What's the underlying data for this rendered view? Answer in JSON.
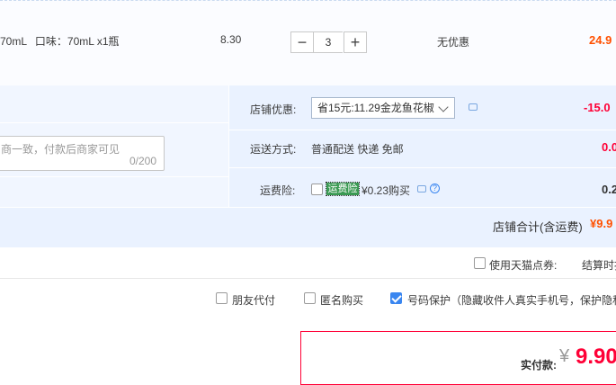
{
  "item": {
    "title_fragment": "70mL",
    "spec": "口味：70mL x1瓶",
    "unit_price": "8.30",
    "quantity": "3",
    "discount": "无优惠",
    "subtotal": "24.9"
  },
  "shop": {
    "remark_placeholder": "商一致，付款后商家可见",
    "remark_counter": "0/200",
    "promo_label": "店铺优惠:",
    "promo_selected": "省15元:11.29金龙鱼花椒",
    "promo_amount": "-15.0",
    "shipping_label": "运送方式:",
    "shipping_value": "普通配送 快递 免邮",
    "shipping_amount": "0.0",
    "insurance_label": "运费险:",
    "insurance_badge": "运费险",
    "insurance_price": "¥0.23购买",
    "insurance_amount": "0.2",
    "total_label": "店铺合计(含运费)",
    "total_amount": "¥9.9"
  },
  "options": {
    "tmall_points": "使用天猫点券:",
    "checkout_note": "结算时扣",
    "friend_pay": "朋友代付",
    "anonymous": "匿名购买",
    "number_protect": "号码保护（隐藏收件人真实手机号，保护隐私）"
  },
  "payment": {
    "label": "实付款:",
    "currency": "¥",
    "amount": "9.90"
  },
  "colors": {
    "accent_red": "#ff0036",
    "accent_orange": "#ff5000",
    "panel_blue": "#eaf2ff",
    "checkbox_blue": "#3a86f0"
  }
}
